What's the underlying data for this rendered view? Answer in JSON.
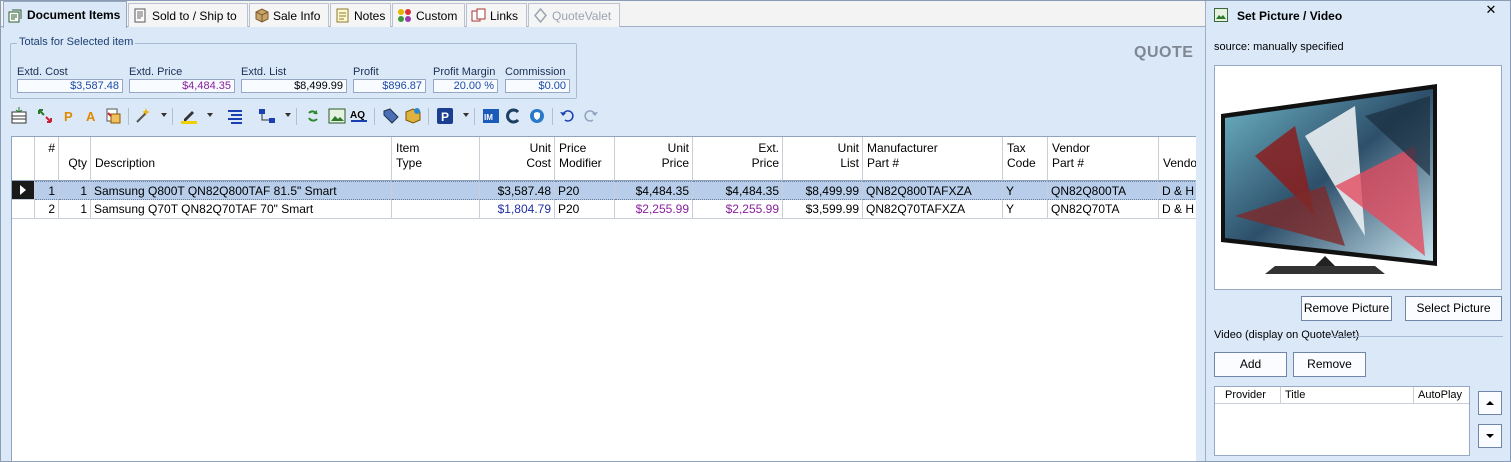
{
  "tabs": [
    {
      "label": "Document Items",
      "icon": "document-items-icon",
      "active": true
    },
    {
      "label": "Sold to / Ship to",
      "icon": "sold-to-icon"
    },
    {
      "label": "Sale Info",
      "icon": "sale-info-icon"
    },
    {
      "label": "Notes",
      "icon": "notes-icon"
    },
    {
      "label": "Custom",
      "icon": "custom-icon"
    },
    {
      "label": "Links",
      "icon": "links-icon"
    },
    {
      "label": "QuoteValet",
      "icon": "quotevalet-icon",
      "disabled": true
    }
  ],
  "totals": {
    "legend": "Totals for Selected item",
    "fields": [
      {
        "label": "Extd. Cost",
        "value": "$3,587.48"
      },
      {
        "label": "Extd. Price",
        "value": "$4,484.35"
      },
      {
        "label": "Extd. List",
        "value": "$8,499.99"
      },
      {
        "label": "Profit",
        "value": "$896.87"
      },
      {
        "label": "Profit Margin",
        "value": "20.00 %"
      },
      {
        "label": "Commission",
        "value": "$0.00"
      }
    ]
  },
  "doc_type": "QUOTE",
  "grid": {
    "headers": {
      "num": "#",
      "qty": "Qty",
      "description": "Description",
      "item_type_1": "Item",
      "item_type_2": "Type",
      "unit_cost_1": "Unit",
      "unit_cost_2": "Cost",
      "price_mod_1": "Price",
      "price_mod_2": "Modifier",
      "unit_price_1": "Unit",
      "unit_price_2": "Price",
      "ext_price_1": "Ext.",
      "ext_price_2": "Price",
      "unit_list_1": "Unit",
      "unit_list_2": "List",
      "mfr_1": "Manufacturer",
      "mfr_2": "Part #",
      "tax_1": "Tax",
      "tax_2": "Code",
      "vendor_part_1": "Vendor",
      "vendor_part_2": "Part #",
      "vendor": "Vendo"
    },
    "rows": [
      {
        "num": "1",
        "qty": "1",
        "description": "Samsung Q800T QN82Q800TAF 81.5\" Smart",
        "item_type": "",
        "unit_cost": "$3,587.48",
        "price_mod": "P20",
        "unit_price": "$4,484.35",
        "ext_price": "$4,484.35",
        "unit_list": "$8,499.99",
        "mfr_part": "QN82Q800TAFXZA",
        "tax": "Y",
        "vendor_part": "QN82Q800TA",
        "vendor": "D & H"
      },
      {
        "num": "2",
        "qty": "1",
        "description": "Samsung Q70T QN82Q70TAF 70\" Smart",
        "item_type": "",
        "unit_cost": "$1,804.79",
        "price_mod": "P20",
        "unit_price": "$2,255.99",
        "ext_price": "$2,255.99",
        "unit_list": "$3,599.99",
        "mfr_part": "QN82Q70TAFXZA",
        "tax": "Y",
        "vendor_part": "QN82Q70TA",
        "vendor": "D & H"
      }
    ]
  },
  "panel": {
    "title": "Set Picture / Video",
    "close": "✕",
    "source": "source: manually specified",
    "remove_picture": "Remove Picture",
    "select_picture": "Select Picture",
    "video_label": "Video (display on QuoteValet)",
    "add": "Add",
    "remove": "Remove",
    "video_headers": {
      "provider": "Provider",
      "title": "Title",
      "autoplay": "AutoPlay"
    }
  },
  "colors": {
    "accent": "#1f2fa8",
    "price": "#8a1f9e",
    "selection": "#b7cde9",
    "background": "#dbe8f8"
  }
}
